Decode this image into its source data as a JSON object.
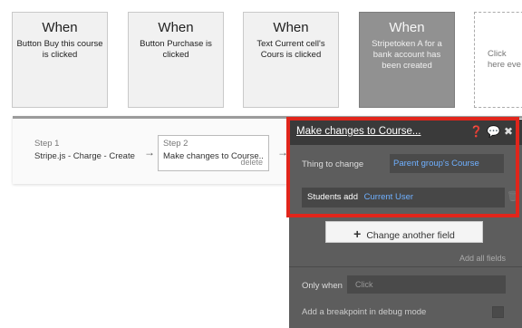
{
  "events": [
    {
      "when": "When",
      "description": "Button Buy this course is clicked"
    },
    {
      "when": "When",
      "description": "Button Purchase is clicked"
    },
    {
      "when": "When",
      "description": "Text Current cell's Cours is clicked"
    },
    {
      "when": "When",
      "description": "Stripetoken A for a bank account has been created"
    },
    {
      "description": "Click here eve"
    }
  ],
  "steps": {
    "step1": {
      "label": "Step 1",
      "name": "Stripe.js - Charge - Create"
    },
    "step2": {
      "label": "Step 2",
      "name": "Make changes to Course...",
      "delete": "delete"
    }
  },
  "panel": {
    "title": "Make changes to Course...",
    "thing_label": "Thing to change",
    "thing_value": "Parent group's Course",
    "field_name": "Students add",
    "field_value": "Current User",
    "change_button": "Change another field",
    "add_all": "Add all fields",
    "only_when_label": "Only when",
    "only_when_placeholder": "Click",
    "debug_label": "Add a breakpoint in debug mode"
  },
  "colors": {
    "highlight": "#e1251b",
    "link": "#6fb0ff"
  },
  "icons": [
    "help-icon",
    "comment-icon",
    "close-icon",
    "trash-icon",
    "plus-icon",
    "arrow-right-icon"
  ]
}
